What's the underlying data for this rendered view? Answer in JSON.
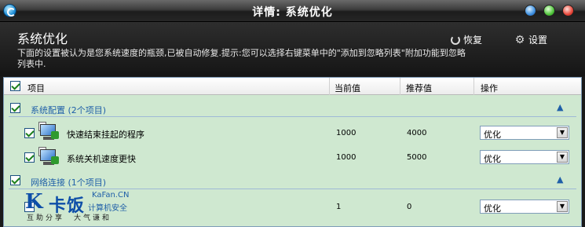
{
  "window": {
    "title": "详情: 系统优化"
  },
  "header": {
    "heading": "系统优化",
    "description": "下面的设置被认为是您系统速度的瓶颈,已被自动修复.提示:您可以选择右键菜单中的\"添加到忽略列表\"附加功能到忽略列表中.",
    "restore_label": "恢复",
    "settings_label": "设置"
  },
  "table": {
    "columns": {
      "item": "项目",
      "current": "当前值",
      "recommended": "推荐值",
      "action": "操作"
    },
    "groups": [
      {
        "label": "系统配置 (2个项目)",
        "collapse": "▲",
        "items": [
          {
            "label": "快速结束挂起的程序",
            "current": "1000",
            "recommended": "4000",
            "action": "优化"
          },
          {
            "label": "系统关机速度更快",
            "current": "1000",
            "recommended": "5000",
            "action": "优化"
          }
        ]
      },
      {
        "label": "网络连接 (1个项目)",
        "collapse": "▲",
        "items": [
          {
            "label": "",
            "current": "1",
            "recommended": "0",
            "action": "优化"
          }
        ]
      }
    ]
  },
  "watermark": {
    "logo": "K",
    "brand": "卡饭",
    "domain": "KaFan.CN",
    "subtitle": "计算机安全",
    "slogan": "互助分享　大气谦和"
  }
}
